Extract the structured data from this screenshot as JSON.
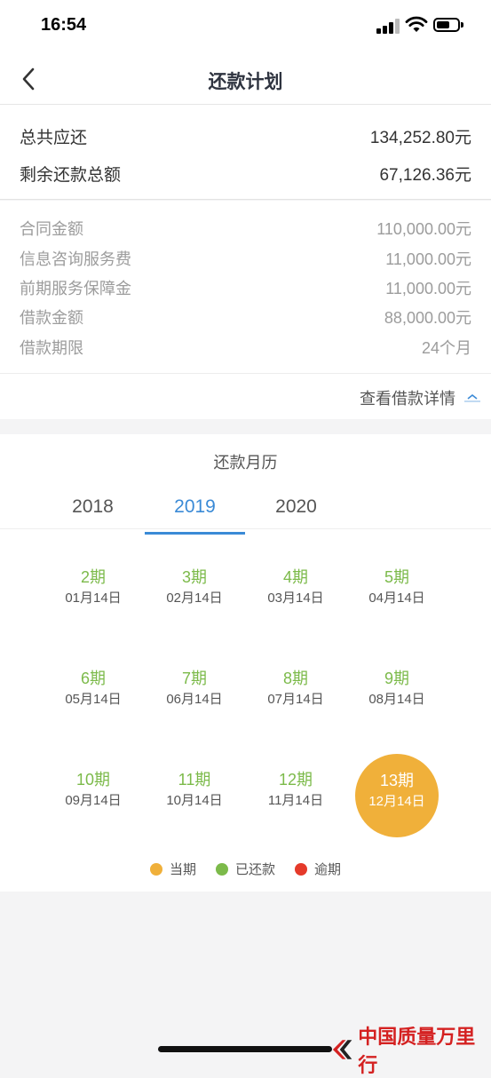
{
  "status_bar": {
    "time": "16:54"
  },
  "nav": {
    "title": "还款计划"
  },
  "summary": {
    "total_due": {
      "label": "总共应还",
      "value": "134,252.80元"
    },
    "remaining": {
      "label": "剩余还款总额",
      "value": "67,126.36元"
    }
  },
  "details": [
    {
      "label": "合同金额",
      "value": "110,000.00元"
    },
    {
      "label": "信息咨询服务费",
      "value": "11,000.00元"
    },
    {
      "label": "前期服务保障金",
      "value": "11,000.00元"
    },
    {
      "label": "借款金额",
      "value": "88,000.00元"
    },
    {
      "label": "借款期限",
      "value": "24个月"
    }
  ],
  "detail_link": {
    "label": "查看借款详情"
  },
  "calendar": {
    "title": "还款月历",
    "years": [
      "2018",
      "2019",
      "2020"
    ],
    "active_year": "2019",
    "periods": [
      {
        "period": "2期",
        "date": "01月14日"
      },
      {
        "period": "3期",
        "date": "02月14日"
      },
      {
        "period": "4期",
        "date": "03月14日"
      },
      {
        "period": "5期",
        "date": "04月14日"
      },
      {
        "period": "6期",
        "date": "05月14日"
      },
      {
        "period": "7期",
        "date": "06月14日"
      },
      {
        "period": "8期",
        "date": "07月14日"
      },
      {
        "period": "9期",
        "date": "08月14日"
      },
      {
        "period": "10期",
        "date": "09月14日"
      },
      {
        "period": "11期",
        "date": "10月14日"
      },
      {
        "period": "12期",
        "date": "11月14日"
      },
      {
        "period": "13期",
        "date": "12月14日",
        "status": "current"
      }
    ],
    "legend": [
      {
        "label": "当期",
        "color": "#f0b03a"
      },
      {
        "label": "已还款",
        "color": "#7cba4a"
      },
      {
        "label": "逾期",
        "color": "#e53a2a"
      }
    ]
  },
  "watermark": {
    "text": "中国质量万里行"
  },
  "colors": {
    "accent": "#3a8ad6",
    "paid": "#7cba4a",
    "current": "#f0b03a",
    "overdue": "#e53a2a"
  }
}
